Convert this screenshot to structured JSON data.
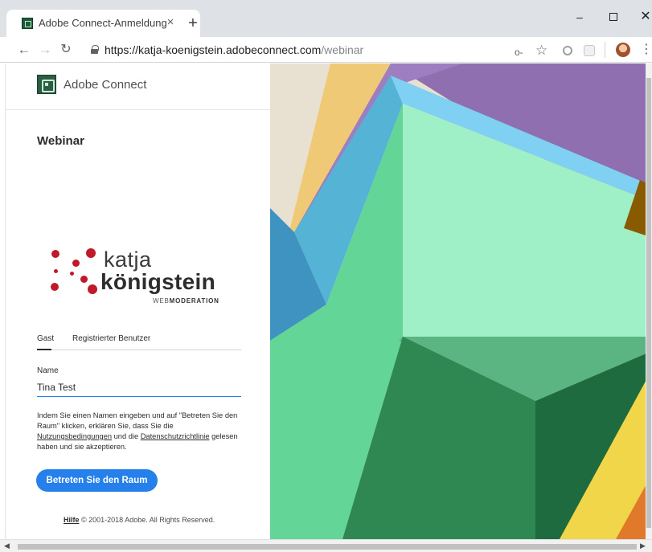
{
  "browser": {
    "tab_title": "Adobe Connect-Anmeldung",
    "tab_close": "×",
    "new_tab": "+",
    "url_host": "https://katja-koenigstein.adobeconnect.com",
    "url_path": "/webinar",
    "icons": [
      "back-arrow-icon",
      "forward-arrow-icon",
      "reload-icon",
      "lock-icon",
      "key-icon",
      "star-icon",
      "extension-icon",
      "profile-avatar",
      "menu-icon"
    ]
  },
  "window_controls": {
    "minimize": "–",
    "close": "✕"
  },
  "app": {
    "name": "Adobe Connect",
    "meeting_title": "Webinar"
  },
  "brand_logo": {
    "line1": "katja",
    "line2": "königstein",
    "line3_light": "WEB",
    "line3_bold": "MODERATION",
    "accent_color": "#c0192a"
  },
  "login_tabs": {
    "guest": "Gast",
    "registered": "Registrierter Benutzer",
    "active": "guest"
  },
  "name_field": {
    "label": "Name",
    "value": "Tina Test"
  },
  "consent": {
    "part1": "Indem Sie einen Namen eingeben und auf \"Betreten Sie den Raum\" klicken, erklären Sie, dass Sie die ",
    "terms_link": "Nutzungsbedingungen",
    "part2": " und die ",
    "privacy_link": "Datenschutzrichtlinie",
    "part3": " gelesen haben und sie akzeptieren."
  },
  "enter_button": {
    "label": "Betreten Sie den Raum",
    "color": "#2680eb"
  },
  "footer": {
    "help_link": "Hilfe",
    "copyright": " © 2001-2018 Adobe. All Rights Reserved."
  }
}
